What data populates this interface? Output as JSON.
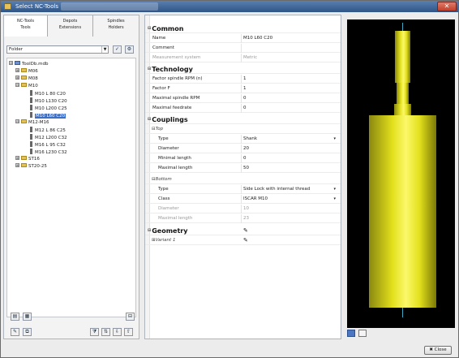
{
  "window": {
    "title": "Select NC-Tools",
    "close_glyph": "✕"
  },
  "left_panel": {
    "tabs": [
      {
        "line1": "NC-Tools",
        "line2": "Tools"
      },
      {
        "line1": "Depots",
        "line2": "Extensions"
      },
      {
        "line1": "Spindles",
        "line2": "Holders"
      }
    ],
    "filter_combo": {
      "value": "Folder"
    },
    "tree": [
      {
        "label": "ToolDb.mdb",
        "kind": "db",
        "expander": "⊟",
        "depth": 0
      },
      {
        "label": "M06",
        "kind": "folder",
        "expander": "⊞",
        "depth": 1
      },
      {
        "label": "M08",
        "kind": "folder",
        "expander": "⊞",
        "depth": 1
      },
      {
        "label": "M10",
        "kind": "folder",
        "expander": "⊟",
        "depth": 1
      },
      {
        "label": "M10 L 80 C20",
        "kind": "tool",
        "expander": "",
        "depth": 2
      },
      {
        "label": "M10 L130 C20",
        "kind": "tool",
        "expander": "",
        "depth": 2
      },
      {
        "label": "M10 L200 C25",
        "kind": "tool",
        "expander": "",
        "depth": 2
      },
      {
        "label": "M10 L60 C20",
        "kind": "tool",
        "expander": "",
        "depth": 2,
        "selected": true
      },
      {
        "label": "M12-M16",
        "kind": "folder",
        "expander": "⊟",
        "depth": 1
      },
      {
        "label": "M12 L 86 C25",
        "kind": "tool",
        "expander": "",
        "depth": 2
      },
      {
        "label": "M12 L200 C32",
        "kind": "tool",
        "expander": "",
        "depth": 2
      },
      {
        "label": "M16 L 95 C32",
        "kind": "tool",
        "expander": "",
        "depth": 2
      },
      {
        "label": "M16 L230 C32",
        "kind": "tool",
        "expander": "",
        "depth": 2
      },
      {
        "label": "ST16",
        "kind": "folder",
        "expander": "⊞",
        "depth": 1
      },
      {
        "label": "ST20-25",
        "kind": "folder",
        "expander": "⊞",
        "depth": 1
      }
    ]
  },
  "properties": {
    "common": {
      "title": "Common",
      "name_key": "Name",
      "name_val": "M10 L60 C20",
      "comment_key": "Comment",
      "comment_val": "",
      "measure_key": "Measurement system",
      "measure_val": "Metric"
    },
    "technology": {
      "title": "Technology",
      "factor_rpm_key": "Factor spindle RPM (n)",
      "factor_rpm_val": "1",
      "factor_f_key": "Factor F",
      "factor_f_val": "1",
      "max_rpm_key": "Maximal spindle RPM",
      "max_rpm_val": "0",
      "max_feed_key": "Maximal feedrate",
      "max_feed_val": "0"
    },
    "couplings": {
      "title": "Couplings",
      "top": {
        "title": "Top",
        "type_key": "Type",
        "type_val": "Shank",
        "diameter_key": "Diameter",
        "diameter_val": "20",
        "minimal_length_key": "Minimal length",
        "minimal_length_val": "0",
        "maximal_length_key": "Maximal length",
        "maximal_length_val": "50"
      },
      "bottom": {
        "title": "Bottom",
        "type_key": "Type",
        "type_val": "Side Lock with internal thread",
        "class_key": "Class",
        "class_val": "ISCAR M10",
        "diameter_key": "Diameter",
        "diameter_val": "10",
        "maximal_length_key": "Maximal length",
        "maximal_length_val": "23"
      }
    },
    "geometry": {
      "title": "Geometry",
      "variant_key": "Variant 1"
    },
    "expand_glyph": "⊟",
    "collapse_glyph": "⊞",
    "dropdown_glyph": "▾",
    "edit_glyph": "✎"
  },
  "preview": {
    "fill_color": "#e3e01c",
    "axis_color": "#3fa6c4",
    "background": "#000000"
  },
  "footer": {
    "close_label": "✖ Close"
  }
}
